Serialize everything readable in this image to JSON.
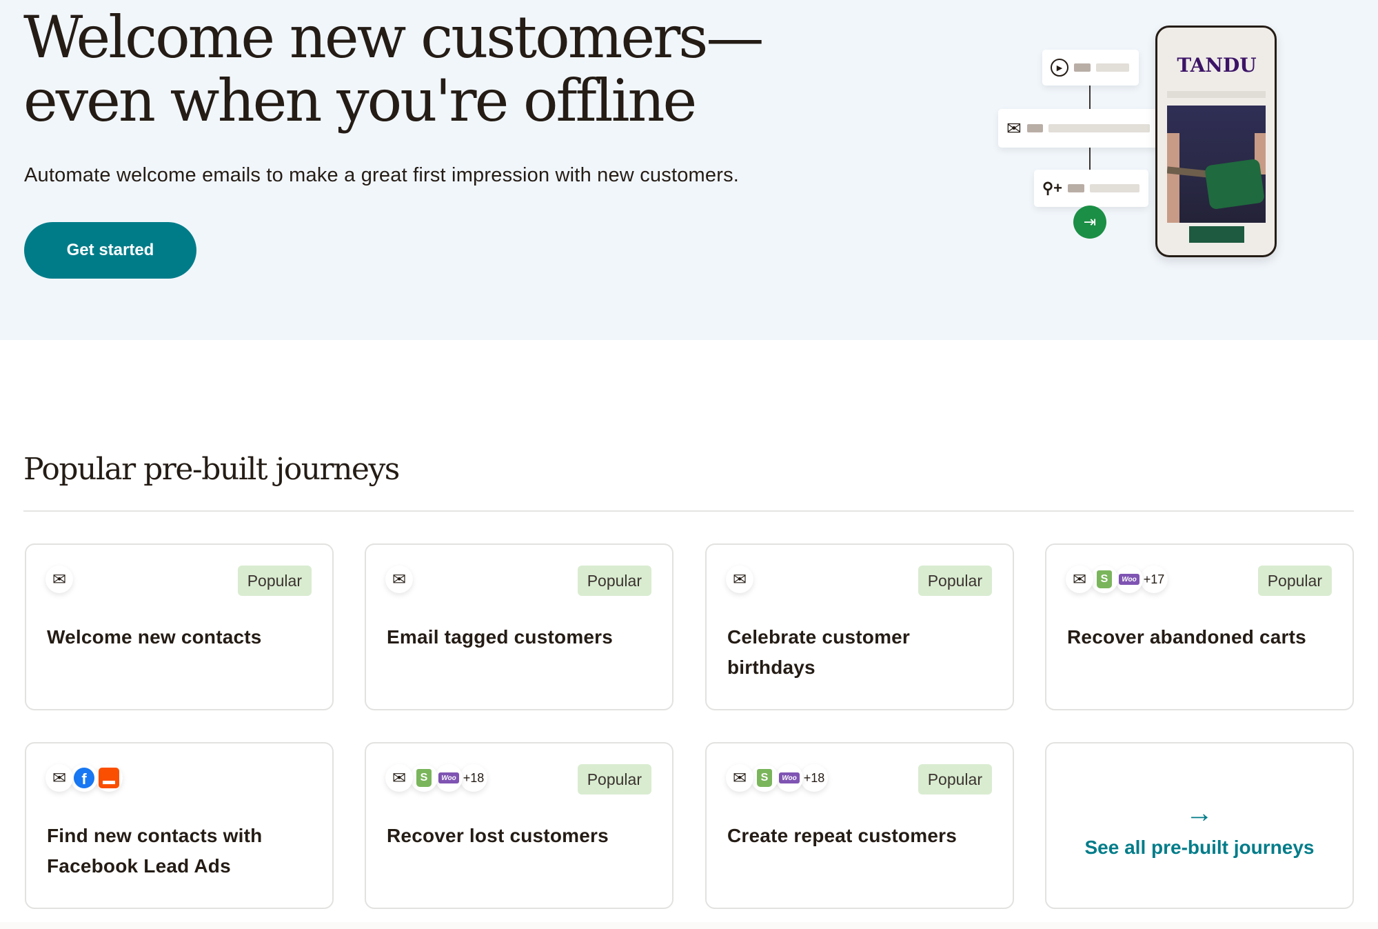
{
  "hero": {
    "title_line1": "Welcome new customers—",
    "title_line2": "even when you're offline",
    "subtitle": "Automate welcome emails to make a great first impression with new customers.",
    "cta_label": "Get started",
    "illustration": {
      "brand_name": "TANDU",
      "steps": [
        {
          "icon": "play-icon",
          "glyph": "▶"
        },
        {
          "icon": "mail-icon",
          "glyph": "✉"
        },
        {
          "icon": "add-contact-icon",
          "glyph": "👤+"
        }
      ],
      "end_icon": "exit-icon",
      "end_glyph": "⇥"
    }
  },
  "section": {
    "title": "Popular pre-built journeys"
  },
  "cards": [
    {
      "title": "Welcome new contacts",
      "badge": "Popular",
      "icons": [
        "mail"
      ],
      "extra_count": ""
    },
    {
      "title": "Email tagged customers",
      "badge": "Popular",
      "icons": [
        "mail"
      ],
      "extra_count": ""
    },
    {
      "title": "Celebrate customer birthdays",
      "badge": "Popular",
      "icons": [
        "mail"
      ],
      "extra_count": ""
    },
    {
      "title": "Recover abandoned carts",
      "badge": "Popular",
      "icons": [
        "mail",
        "shopify",
        "woocommerce"
      ],
      "extra_count": "+17"
    },
    {
      "title": "Find new contacts with Facebook Lead Ads",
      "badge": "",
      "icons": [
        "mail",
        "facebook",
        "lead-ads"
      ],
      "extra_count": ""
    },
    {
      "title": "Recover lost customers",
      "badge": "Popular",
      "icons": [
        "mail",
        "shopify",
        "woocommerce"
      ],
      "extra_count": "+18"
    },
    {
      "title": "Create repeat customers",
      "badge": "Popular",
      "icons": [
        "mail",
        "shopify",
        "woocommerce"
      ],
      "extra_count": "+18"
    }
  ],
  "see_all": {
    "label": "See all pre-built journeys",
    "arrow": "→"
  },
  "glyphs": {
    "mail": "✉",
    "shopify": "S",
    "woocommerce": "Woo",
    "facebook": "f"
  },
  "colors": {
    "accent": "#007c89",
    "hero_bg": "#f1f6fb",
    "badge_bg": "#d9ecd0",
    "text": "#241c15"
  }
}
